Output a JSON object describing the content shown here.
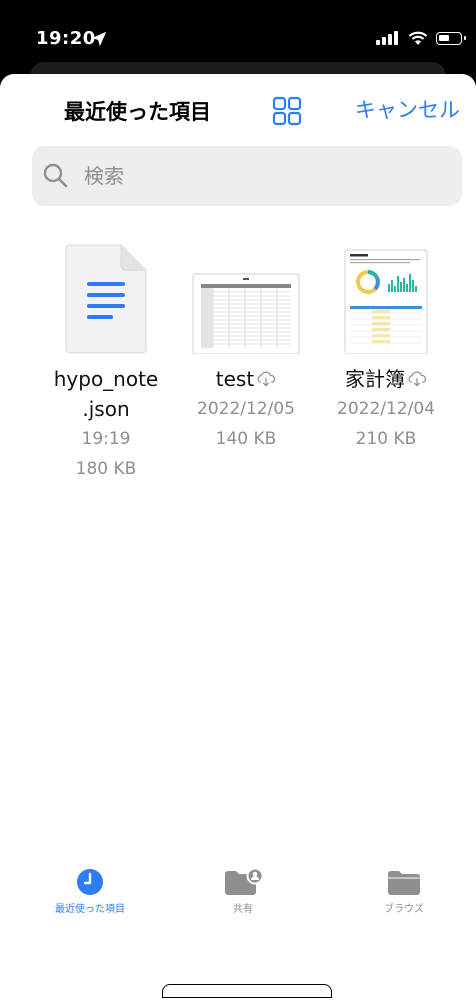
{
  "status_bar": {
    "time": "19:20"
  },
  "header": {
    "title": "最近使った項目",
    "cancel_label": "キャンセル"
  },
  "search": {
    "placeholder": "検索"
  },
  "files": [
    {
      "name_line1": "hypo_note",
      "name_line2": ".json",
      "date": "19:19",
      "size": "180 KB",
      "icon": "document-icon"
    },
    {
      "name": "test",
      "date": "2022/12/05",
      "size": "140 KB",
      "icon": "spreadsheet-thumbnail",
      "cloud": true
    },
    {
      "name": "家計簿",
      "date": "2022/12/04",
      "size": "210 KB",
      "icon": "report-thumbnail",
      "cloud": true
    }
  ],
  "tabs": [
    {
      "label": "最近使った項目",
      "icon": "clock-icon",
      "active": true
    },
    {
      "label": "共有",
      "icon": "shared-folder-icon",
      "active": false
    },
    {
      "label": "ブラウズ",
      "icon": "folder-icon",
      "active": false
    }
  ],
  "colors": {
    "accent": "#2f7cf6",
    "doc_blue": "#3478f6",
    "inactive": "#8e8e93"
  }
}
